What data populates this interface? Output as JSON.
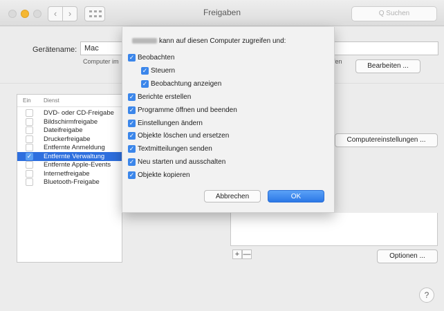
{
  "window": {
    "title": "Freigaben",
    "search_placeholder": "Q Suchen",
    "nav_back": "‹",
    "nav_forward": "›"
  },
  "device": {
    "label": "Gerätename:",
    "value": "Mac",
    "sub_text": "Computer im",
    "sub_text_right": "ifen",
    "edit_button": "Bearbeiten ..."
  },
  "services": {
    "col_on": "Ein",
    "col_service": "Dienst",
    "items": [
      {
        "label": "DVD- oder CD-Freigabe",
        "checked": false
      },
      {
        "label": "Bildschirmfreigabe",
        "checked": false
      },
      {
        "label": "Dateifreigabe",
        "checked": false
      },
      {
        "label": "Druckerfreigabe",
        "checked": false
      },
      {
        "label": "Entfernte Anmeldung",
        "checked": false
      },
      {
        "label": "Entfernte Verwaltung",
        "checked": true
      },
      {
        "label": "Entfernte Apple-Events",
        "checked": false
      },
      {
        "label": "Internetfreigabe",
        "checked": false
      },
      {
        "label": "Bluetooth-Freigabe",
        "checked": false
      }
    ]
  },
  "right_panel": {
    "computer_settings_button": "Computereinstellungen ...",
    "options_button": "Optionen ...",
    "add": "+",
    "remove": "—",
    "help": "?"
  },
  "sheet": {
    "title_suffix": "kann auf diesen Computer zugreifen und:",
    "options": [
      {
        "label": "Beobachten",
        "checked": true,
        "indent": 0
      },
      {
        "label": "Steuern",
        "checked": true,
        "indent": 1
      },
      {
        "label": "Beobachtung anzeigen",
        "checked": true,
        "indent": 1
      },
      {
        "label": "Berichte erstellen",
        "checked": true,
        "indent": 0
      },
      {
        "label": "Programme öffnen und beenden",
        "checked": true,
        "indent": 0
      },
      {
        "label": "Einstellungen ändern",
        "checked": true,
        "indent": 0
      },
      {
        "label": "Objekte löschen und ersetzen",
        "checked": true,
        "indent": 0
      },
      {
        "label": "Textmitteilungen senden",
        "checked": true,
        "indent": 0
      },
      {
        "label": "Neu starten und ausschalten",
        "checked": true,
        "indent": 0
      },
      {
        "label": "Objekte kopieren",
        "checked": true,
        "indent": 0
      }
    ],
    "cancel_button": "Abbrechen",
    "ok_button": "OK"
  },
  "colors": {
    "accent": "#2e6fde",
    "ok_button": "#3b86ea",
    "minimize_light": "#f5b731"
  }
}
